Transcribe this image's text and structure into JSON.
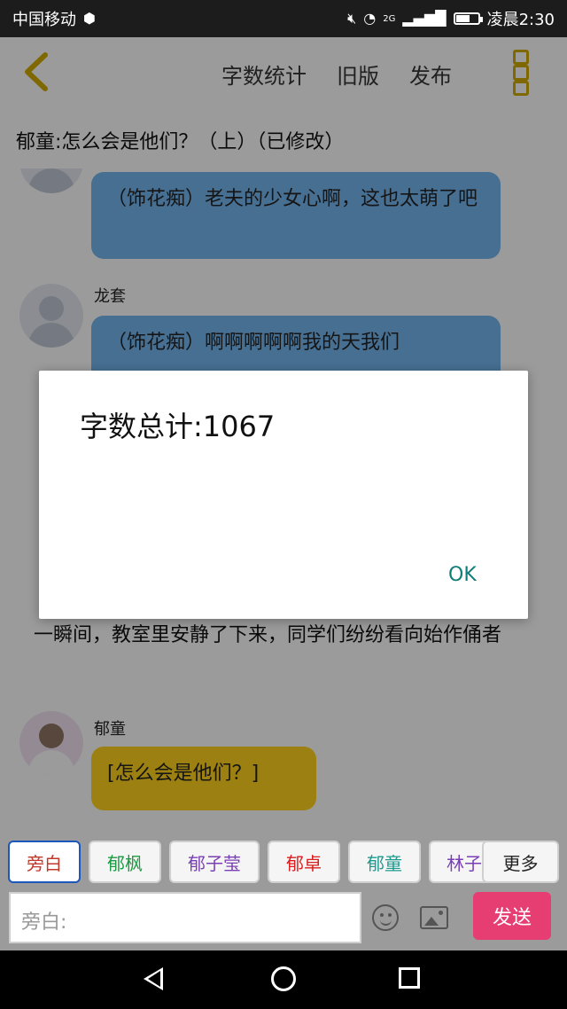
{
  "status_bar": {
    "carrier": "中国移动",
    "network": "2G",
    "time": "凌晨2:30",
    "battery_level": 0.6
  },
  "top_bar": {
    "tabs": [
      "字数统计",
      "旧版",
      "发布"
    ]
  },
  "story_title": "郁童:怎么会是他们？（上）（已修改）",
  "messages": [
    {
      "type": "bubble",
      "color": "blue",
      "text": "（饰花痴）老夫的少女心啊，这也太萌了吧"
    },
    {
      "type": "bubble",
      "speaker": "龙套",
      "color": "blue",
      "text": "（饰花痴）啊啊啊啊啊我的天我们"
    },
    {
      "type": "narration",
      "text": "一瞬间，教室里安静了下来，同学们纷纷看向始作俑者"
    },
    {
      "type": "bubble",
      "speaker": "郁童",
      "color": "yellow",
      "text": "[怎么会是他们？]"
    }
  ],
  "character_chips": [
    {
      "label": "旁白",
      "color": "#c0392b",
      "active": true
    },
    {
      "label": "郁枫",
      "color": "#1e9a44"
    },
    {
      "label": "郁子莹",
      "color": "#7b3fb5"
    },
    {
      "label": "郁卓",
      "color": "#d81e1e"
    },
    {
      "label": "郁童",
      "color": "#1e9a90"
    },
    {
      "label": "林子",
      "color": "#7b3fb5"
    },
    {
      "label": "更多",
      "color": "#222222"
    }
  ],
  "input": {
    "placeholder": "旁白:"
  },
  "send_button": "发送",
  "dialog": {
    "message": "字数总计:1067",
    "ok_label": "OK"
  }
}
